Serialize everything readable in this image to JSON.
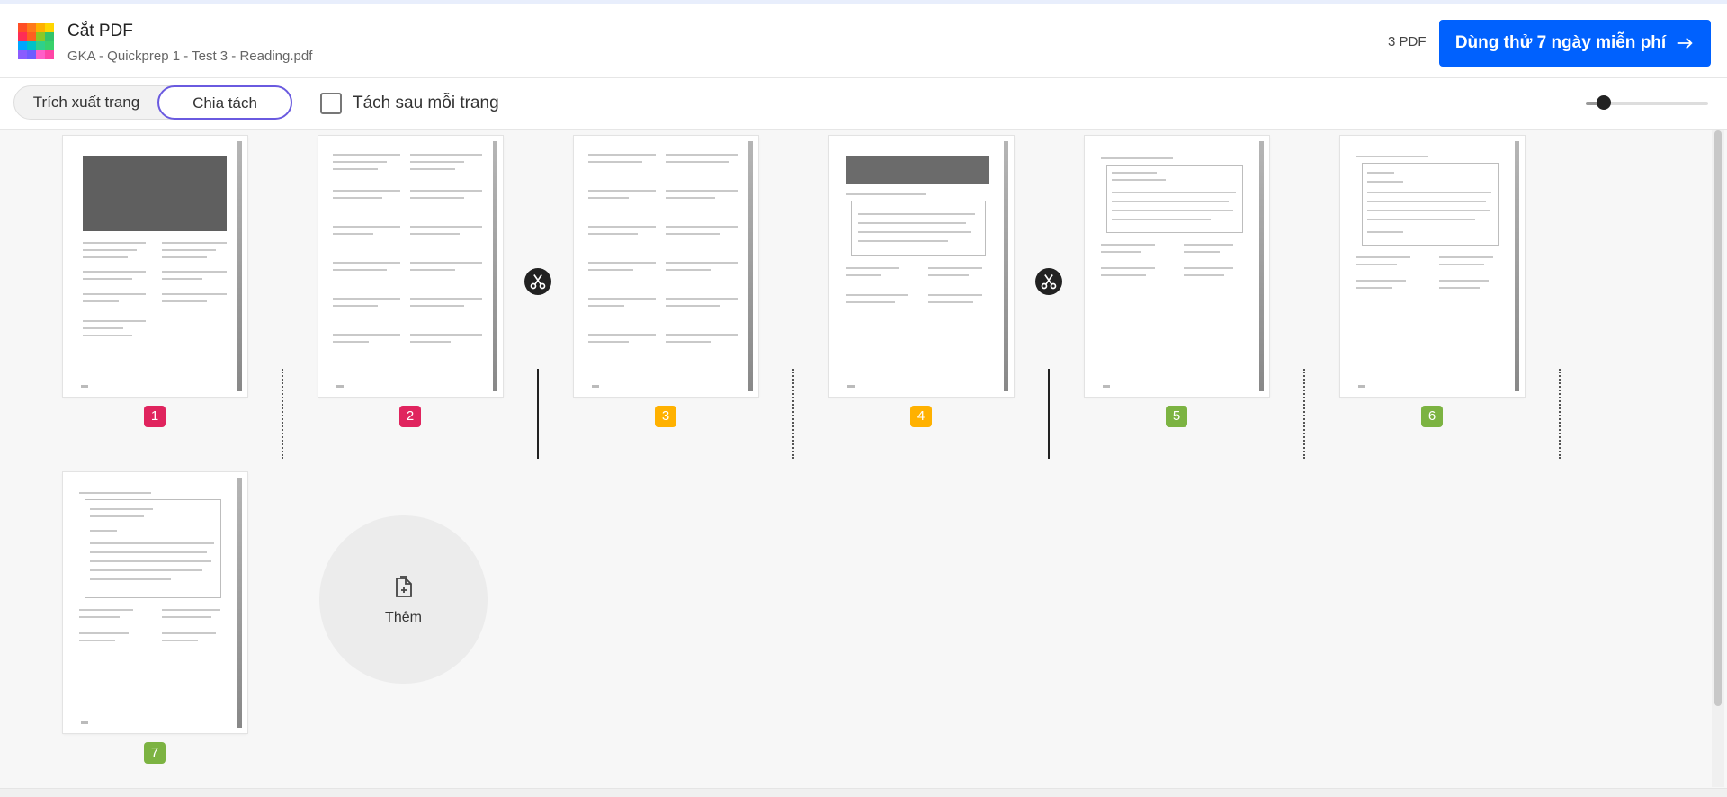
{
  "app": {
    "title": "Cắt PDF",
    "filename": "GKA - Quickprep 1 - Test 3 - Reading.pdf",
    "pdf_count": "3 PDF",
    "trial_button": "Dùng thử 7 ngày miễn phí"
  },
  "toolbar": {
    "mode_extract": "Trích xuất trang",
    "mode_split": "Chia tách",
    "active_mode": "Chia tách",
    "split_after_each_label": "Tách sau mỗi trang",
    "split_after_each_checked": false
  },
  "zoom_level": 0.15,
  "pages": [
    {
      "label": "1",
      "color": "#e0245e"
    },
    {
      "label": "2",
      "color": "#e0245e"
    },
    {
      "label": "3",
      "color": "#ffb100"
    },
    {
      "label": "4",
      "color": "#ffb100"
    },
    {
      "label": "5",
      "color": "#7cb342"
    },
    {
      "label": "6",
      "color": "#7cb342"
    },
    {
      "label": "7",
      "color": "#7cb342"
    }
  ],
  "split_points": {
    "after_page_2": true,
    "after_page_4": true
  },
  "add_label": "Thêm",
  "icons": {
    "logo": "app-logo-grid",
    "arrow": "arrow-right-icon",
    "scissors": "scissors-icon",
    "add": "add-file-icon"
  },
  "colors": {
    "primary": "#0061fe",
    "active_border": "#6a5ae0"
  }
}
